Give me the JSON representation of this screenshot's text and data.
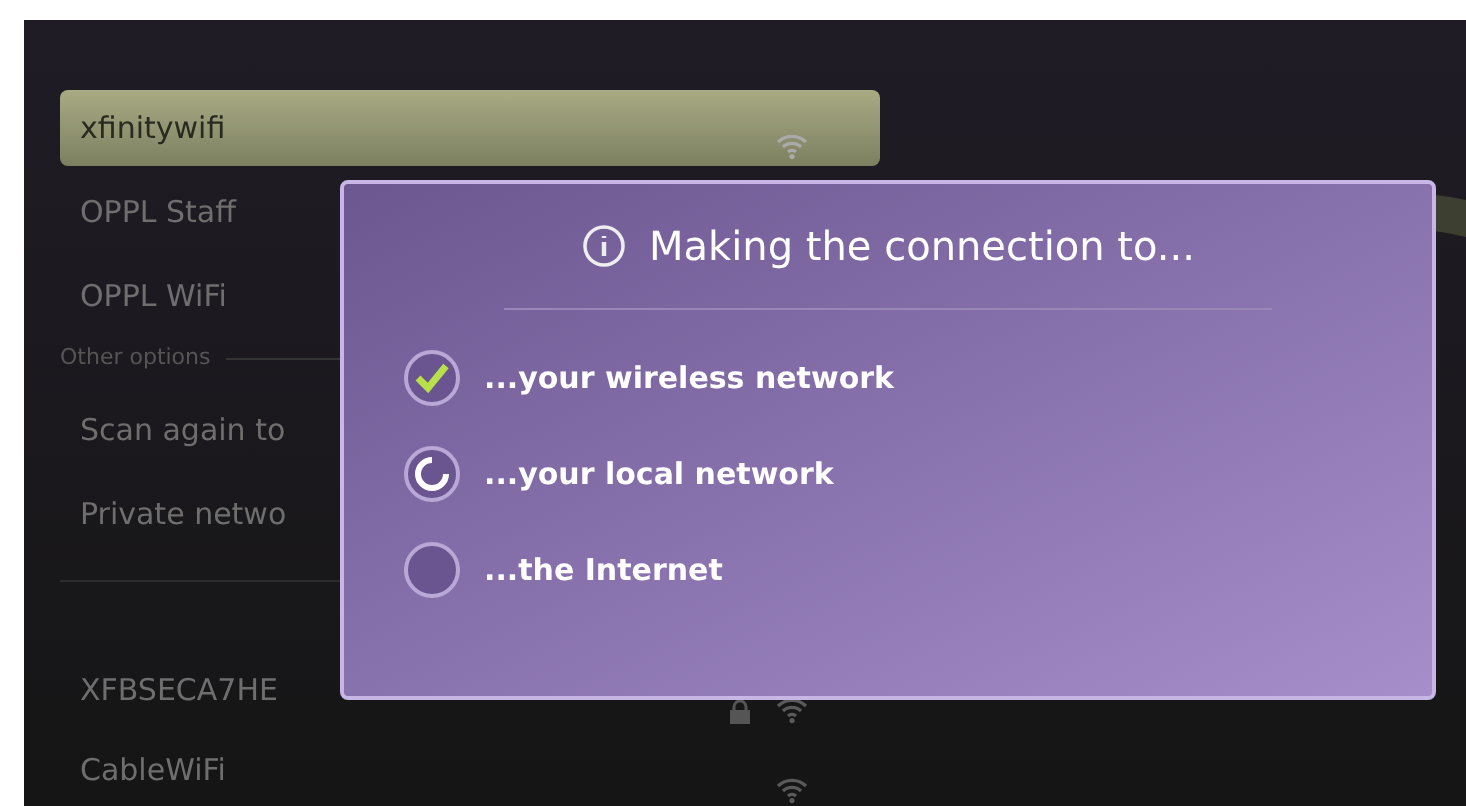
{
  "networks": [
    {
      "name": "xfinitywifi",
      "selected": true,
      "locked": false,
      "signal": true
    },
    {
      "name": "OPPL Staff",
      "selected": false
    },
    {
      "name": "OPPL WiFi",
      "selected": false
    }
  ],
  "other_options": {
    "heading": "Other options",
    "items": [
      {
        "label": "Scan again to"
      },
      {
        "label": "Private netwo"
      }
    ]
  },
  "more_networks": [
    {
      "name": "XFBSECA7HE",
      "selected": false,
      "locked": true,
      "signal": true
    },
    {
      "name": "CableWiFi",
      "selected": false,
      "locked": false,
      "signal": true
    }
  ],
  "dialog": {
    "title": "Making the connection to...",
    "steps": [
      {
        "label": "...your wireless network",
        "kind": "check"
      },
      {
        "label": "...your local network",
        "kind": "spinner"
      },
      {
        "label": "...the Internet",
        "kind": "empty"
      }
    ]
  }
}
